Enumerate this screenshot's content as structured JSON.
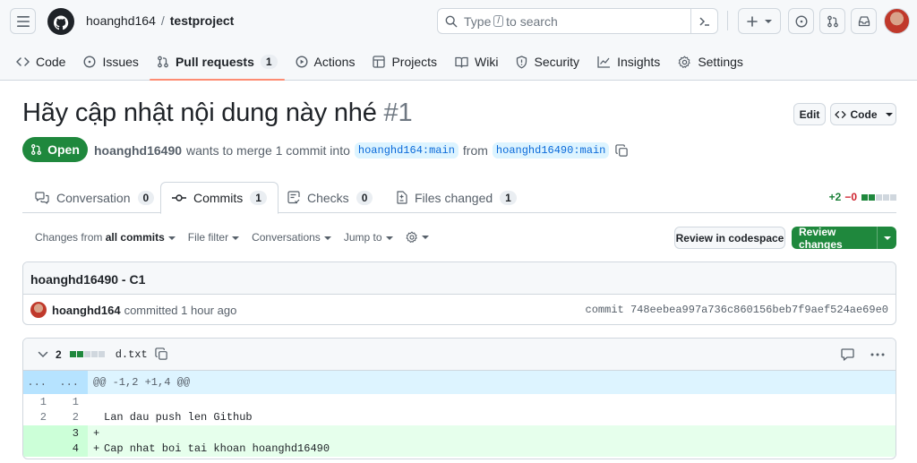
{
  "header": {
    "owner": "hoanghd164",
    "separator": "/",
    "repo": "testproject",
    "search": {
      "pre": "Type",
      "key": "/",
      "post": "to search"
    }
  },
  "repo_nav": {
    "items": [
      {
        "label": "Code",
        "icon": "code-icon"
      },
      {
        "label": "Issues",
        "icon": "issue-icon"
      },
      {
        "label": "Pull requests",
        "icon": "pull-request-icon",
        "count": "1"
      },
      {
        "label": "Actions",
        "icon": "play-icon"
      },
      {
        "label": "Projects",
        "icon": "table-icon"
      },
      {
        "label": "Wiki",
        "icon": "book-icon"
      },
      {
        "label": "Security",
        "icon": "shield-icon"
      },
      {
        "label": "Insights",
        "icon": "graph-icon"
      },
      {
        "label": "Settings",
        "icon": "gear-icon"
      }
    ]
  },
  "pr": {
    "title": "Hãy cập nhật nội dung này nhé",
    "number": "#1",
    "edit_label": "Edit",
    "code_label": "Code",
    "state": "Open",
    "author": "hoanghd16490",
    "merge_text": "wants to merge 1 commit into",
    "base_branch": "hoanghd164:main",
    "from_text": "from",
    "head_branch": "hoanghd16490:main"
  },
  "tabs": [
    {
      "label": "Conversation",
      "count": "0",
      "icon": "comment-discussion-icon"
    },
    {
      "label": "Commits",
      "count": "1",
      "icon": "git-commit-icon"
    },
    {
      "label": "Checks",
      "count": "0",
      "icon": "checklist-icon"
    },
    {
      "label": "Files changed",
      "count": "1",
      "icon": "file-diff-icon"
    }
  ],
  "diffstat": {
    "additions": "+2",
    "deletions": "−0"
  },
  "toolbar": {
    "changes_from": "Changes from",
    "changes_value": "all commits",
    "file_filter": "File filter",
    "conversations": "Conversations",
    "jump_to": "Jump to",
    "review_codespace": "Review in codespace",
    "review_changes": "Review changes"
  },
  "commit": {
    "message": "hoanghd16490 - C1",
    "author": "hoanghd164",
    "time_text": "committed 1 hour ago",
    "sha_text": "commit 748eebea997a736c860156beb7f9aef524ae69e0"
  },
  "file": {
    "change_count": "2",
    "name": "d.txt",
    "hunk": "@@ -1,2 +1,4 @@",
    "hunk_left": "...",
    "hunk_right": "...",
    "lines": [
      {
        "old": "1",
        "new": "1",
        "sign": "",
        "text": ""
      },
      {
        "old": "2",
        "new": "2",
        "sign": "",
        "text": "Lan dau push len Github"
      },
      {
        "old": "",
        "new": "3",
        "sign": "+",
        "text": ""
      },
      {
        "old": "",
        "new": "4",
        "sign": "+",
        "text": "Cap nhat boi tai khoan hoanghd16490"
      }
    ]
  },
  "colors": {
    "accent_green": "#1f883d",
    "underline_orange": "#fd8c73",
    "link_blue": "#0969da"
  }
}
